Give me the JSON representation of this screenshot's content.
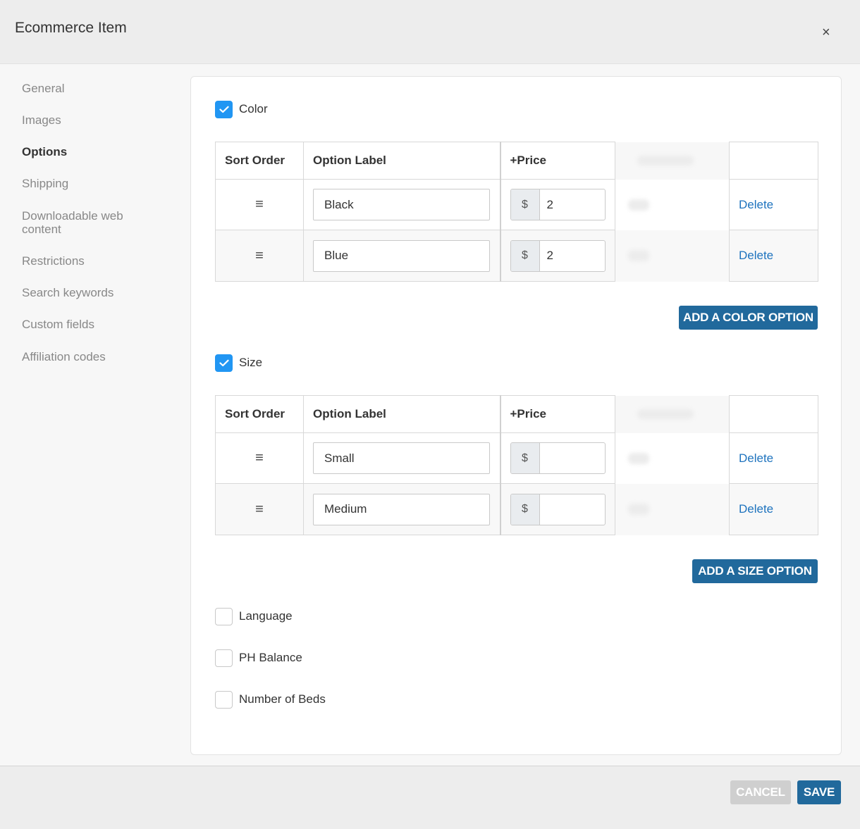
{
  "header": {
    "title": "Ecommerce Item",
    "close_icon": "×"
  },
  "sidebar": {
    "items": [
      {
        "label": "General",
        "active": false
      },
      {
        "label": "Images",
        "active": false
      },
      {
        "label": "Options",
        "active": true
      },
      {
        "label": "Shipping",
        "active": false
      },
      {
        "label": "Downloadable web content",
        "active": false
      },
      {
        "label": "Restrictions",
        "active": false
      },
      {
        "label": "Search keywords",
        "active": false
      },
      {
        "label": "Custom fields",
        "active": false
      },
      {
        "label": "Affiliation codes",
        "active": false
      }
    ]
  },
  "columns": {
    "sort": "Sort Order",
    "label": "Option Label",
    "price": "+Price"
  },
  "sort_icon": "≡",
  "currency": "$",
  "delete_label": "Delete",
  "color": {
    "title": "Color",
    "checked": true,
    "rows": [
      {
        "label": "Black",
        "price": "2"
      },
      {
        "label": "Blue",
        "price": "2"
      }
    ],
    "add_label": "ADD A COLOR OPTION"
  },
  "size": {
    "title": "Size",
    "checked": true,
    "rows": [
      {
        "label": "Small",
        "price": ""
      },
      {
        "label": "Medium",
        "price": ""
      }
    ],
    "add_label": "ADD A SIZE OPTION"
  },
  "other_options": [
    {
      "label": "Language",
      "checked": false
    },
    {
      "label": "PH Balance",
      "checked": false
    },
    {
      "label": "Number of Beds",
      "checked": false
    }
  ],
  "footer": {
    "cancel_label": "CANCEL",
    "save_label": "SAVE"
  },
  "colors": {
    "accent": "#21699c",
    "checkbox": "#2196f3",
    "link": "#1e73be"
  }
}
